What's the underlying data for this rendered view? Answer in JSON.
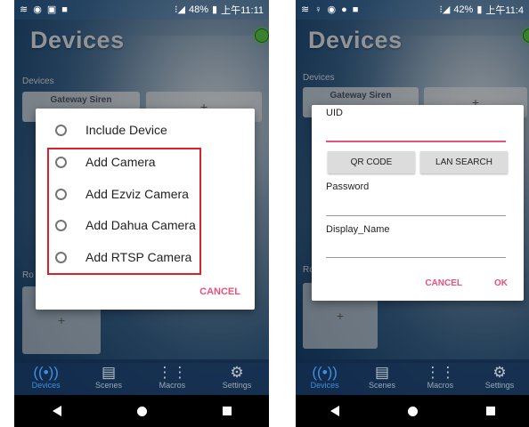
{
  "left": {
    "status": {
      "battery": "48%",
      "time": "上午11:11"
    },
    "app_title": "Devices",
    "section_devices": "Devices",
    "device_tile": "Gateway Siren",
    "add_symbol": "+",
    "section_rooms": "Ro",
    "dialog": {
      "options": [
        "Include Device",
        "Add Camera",
        "Add Ezviz Camera",
        "Add Dahua Camera",
        "Add RTSP Camera"
      ],
      "cancel": "CANCEL"
    },
    "tabs": [
      "Devices",
      "Scenes",
      "Macros",
      "Settings"
    ]
  },
  "right": {
    "status": {
      "battery": "42%",
      "time": "上午11:4"
    },
    "app_title": "Devices",
    "section_devices": "Devices",
    "device_tile": "Gateway Siren",
    "add_symbol": "+",
    "section_rooms": "Ro",
    "dialog": {
      "uid_label": "UID",
      "qr_button": "QR CODE",
      "lan_button": "LAN SEARCH",
      "password_label": "Password",
      "display_name_label": "Display_Name",
      "cancel": "CANCEL",
      "ok": "OK"
    },
    "tabs": [
      "Devices",
      "Scenes",
      "Macros",
      "Settings"
    ]
  },
  "colors": {
    "accent": "#e8517a",
    "highlight": "#d8232a",
    "online": "#5fd04a"
  }
}
